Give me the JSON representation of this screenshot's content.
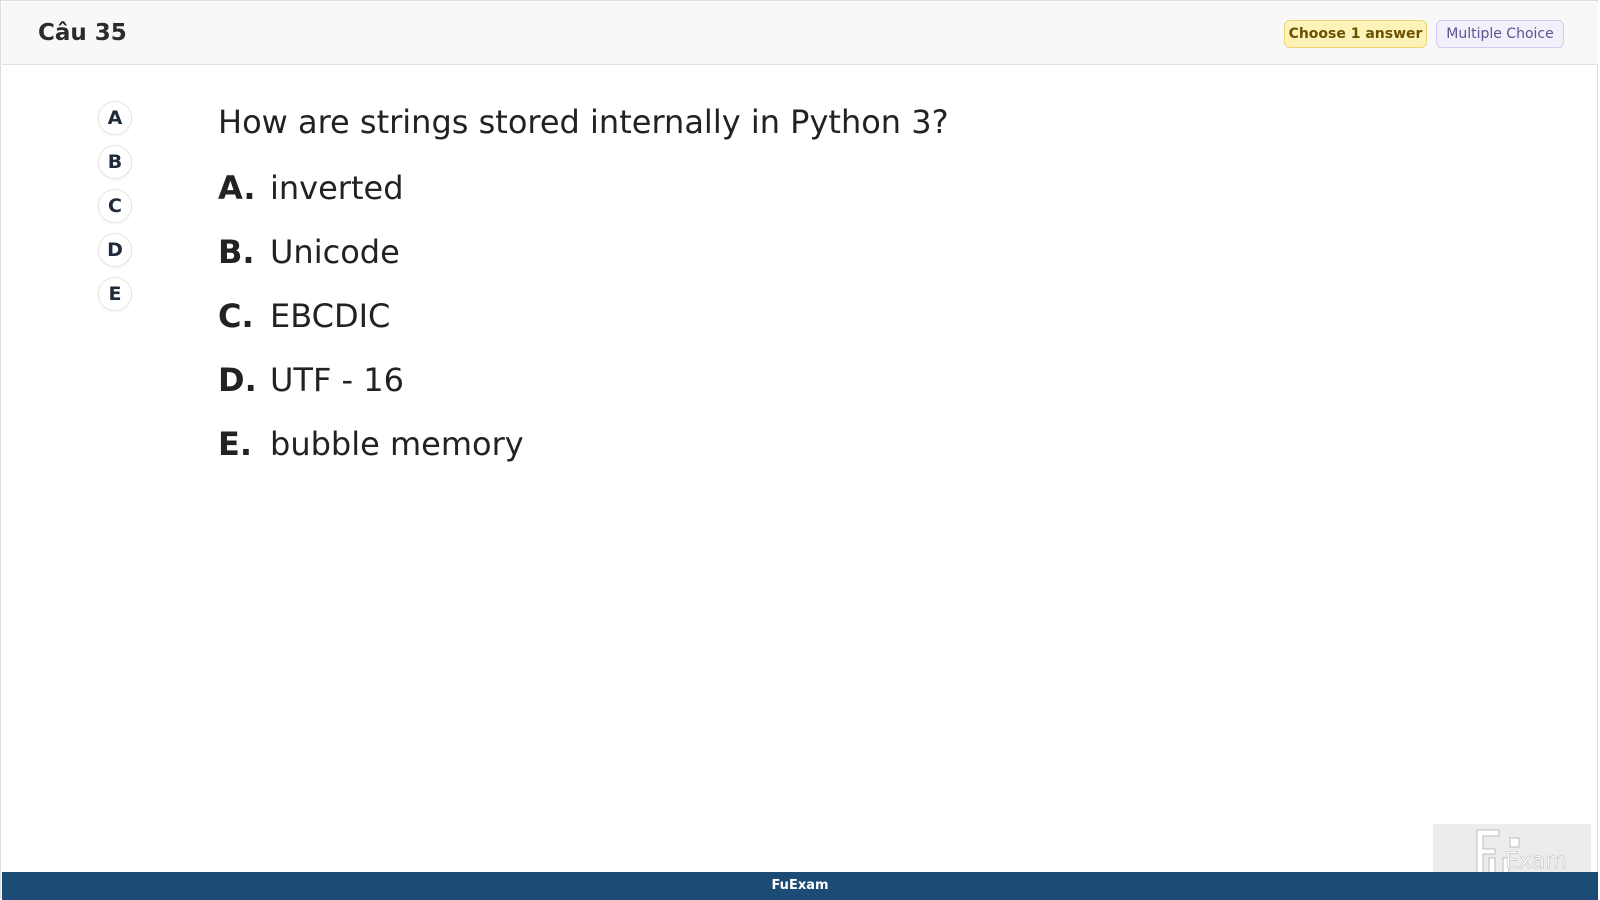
{
  "header": {
    "question_number": "Câu 35",
    "choose_badge": "Choose 1 answer",
    "type_badge": "Multiple Choice"
  },
  "answer_buttons": [
    "A",
    "B",
    "C",
    "D",
    "E"
  ],
  "question": {
    "text": "How are strings stored internally in Python 3?",
    "options": [
      {
        "letter": "A.",
        "text": "inverted"
      },
      {
        "letter": "B.",
        "text": "Unicode"
      },
      {
        "letter": "C.",
        "text": "EBCDIC"
      },
      {
        "letter": "D.",
        "text": "UTF - 16"
      },
      {
        "letter": "E.",
        "text": "bubble memory"
      }
    ]
  },
  "footer": {
    "brand": "FuExam"
  },
  "watermark": {
    "logo_text": "FUExam"
  },
  "colors": {
    "footer_bg": "#1c4b75",
    "choose_badge_bg": "#fdf2b7",
    "type_badge_bg": "#f1f0fb"
  }
}
